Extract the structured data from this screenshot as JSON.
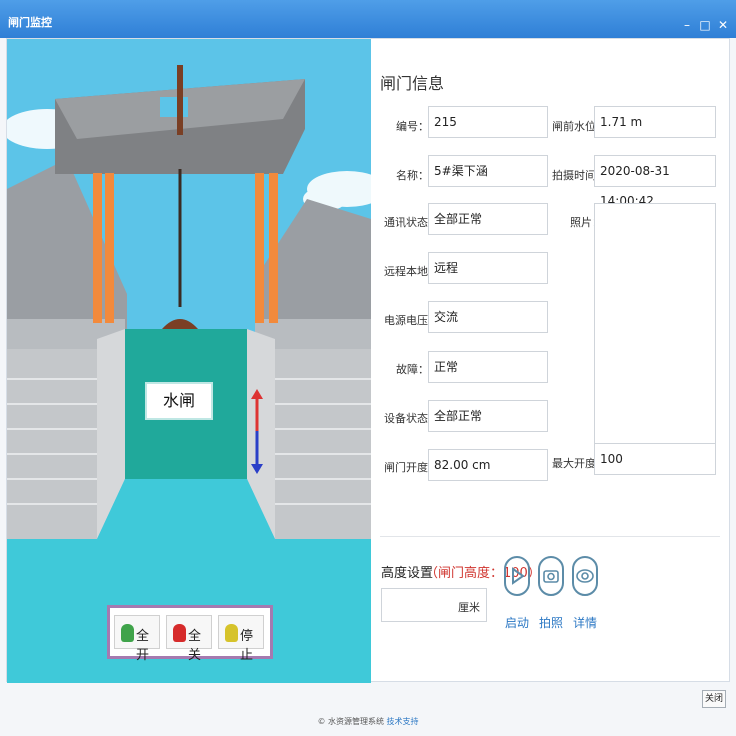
{
  "window": {
    "title": "闸门监控",
    "min_icon": "minimize-icon",
    "max_icon": "maximize-icon",
    "close_icon": "close-icon"
  },
  "scene": {
    "gate_label": "水闸",
    "colors": {
      "sky": "#5cc4e8",
      "water": "#3fc9d9",
      "gate": "#20a99b",
      "beam": "#8a8a8a",
      "pillar": "#f28a3c"
    },
    "controls": [
      {
        "label": "全开",
        "lamp": "#3fa34a"
      },
      {
        "label": "全关",
        "lamp": "#d62b2b"
      },
      {
        "label": "停止",
        "lamp": "#d6c32b"
      }
    ]
  },
  "info": {
    "title": "闸门信息",
    "labels": {
      "id": "编号：",
      "name": "名称：",
      "comm": "通讯状态：",
      "mode": "远程本地：",
      "voltage": "电源电压：",
      "fault": "故障：",
      "device": "设备状态：",
      "opening": "闸门开度：",
      "level": "闸前水位：",
      "time": "拍摄时间：",
      "photo": "照片：",
      "max_open": "最大开度："
    },
    "values": {
      "id": "215",
      "name": "5#渠下涵",
      "comm": "全部正常",
      "mode": "远程",
      "voltage": "交流",
      "fault": "正常",
      "device": "全部正常",
      "opening": "82.00 cm",
      "level": "1.71 m",
      "time": "2020-08-31 14:00:42",
      "max_open": "100"
    }
  },
  "height_setting": {
    "label": "高度设置",
    "gate_height": "（闸门高度：100）",
    "unit": "厘米",
    "value": ""
  },
  "actions": [
    {
      "label": "启动",
      "icon": "play-icon"
    },
    {
      "label": "拍照",
      "icon": "camera-icon"
    },
    {
      "label": "详情",
      "icon": "eye-icon"
    }
  ],
  "close_label": "关闭",
  "footer": {
    "text": "© 水资源管理系统 ",
    "link": "技术支持"
  }
}
